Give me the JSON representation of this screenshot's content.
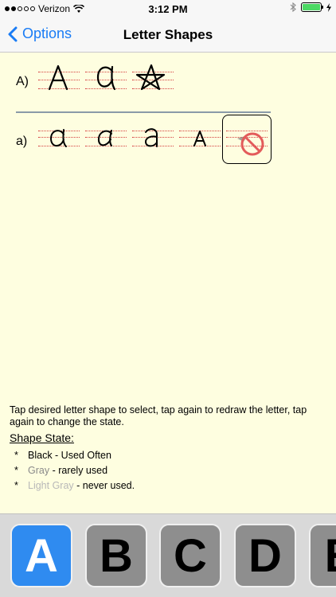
{
  "status_bar": {
    "carrier": "Verizon",
    "time": "3:12 PM",
    "signal_bars_filled": 2,
    "signal_bars_total": 5
  },
  "nav": {
    "back_label": "Options",
    "title": "Letter Shapes"
  },
  "uppercase_row": {
    "label": "A)",
    "shapes": [
      {
        "glyph": "A",
        "state": "Black"
      },
      {
        "glyph": "a",
        "state": "Black"
      },
      {
        "glyph": "star",
        "state": "Black"
      }
    ]
  },
  "lowercase_row": {
    "label": "a)",
    "shapes": [
      {
        "glyph": "a",
        "state": "Black"
      },
      {
        "glyph": "a",
        "state": "Black"
      },
      {
        "glyph": "a",
        "state": "Black"
      },
      {
        "glyph": "A",
        "state": "Black"
      },
      {
        "glyph": "no-symbol",
        "state": "selected"
      }
    ]
  },
  "instructions": "Tap desired letter shape to select, tap again to redraw the letter, tap again to change the state.",
  "shape_state": {
    "title": "Shape State:",
    "items": [
      {
        "bullet": "*",
        "name": "Black",
        "desc": " - Used Often",
        "color": "#000000"
      },
      {
        "bullet": "*",
        "name": "Gray",
        "desc": " - rarely used",
        "color": "#8a8a8a"
      },
      {
        "bullet": "*",
        "name": "Light Gray",
        "desc": " - never used.",
        "color": "#b8b8b8"
      }
    ]
  },
  "letter_bar": {
    "keys": [
      "A",
      "B",
      "C",
      "D",
      "E"
    ],
    "active": "A"
  },
  "colors": {
    "accent": "#1a7cf5",
    "active_key": "#2f8bf0",
    "guide_line": "#d43c3c",
    "no_symbol": "#e35b5b"
  }
}
